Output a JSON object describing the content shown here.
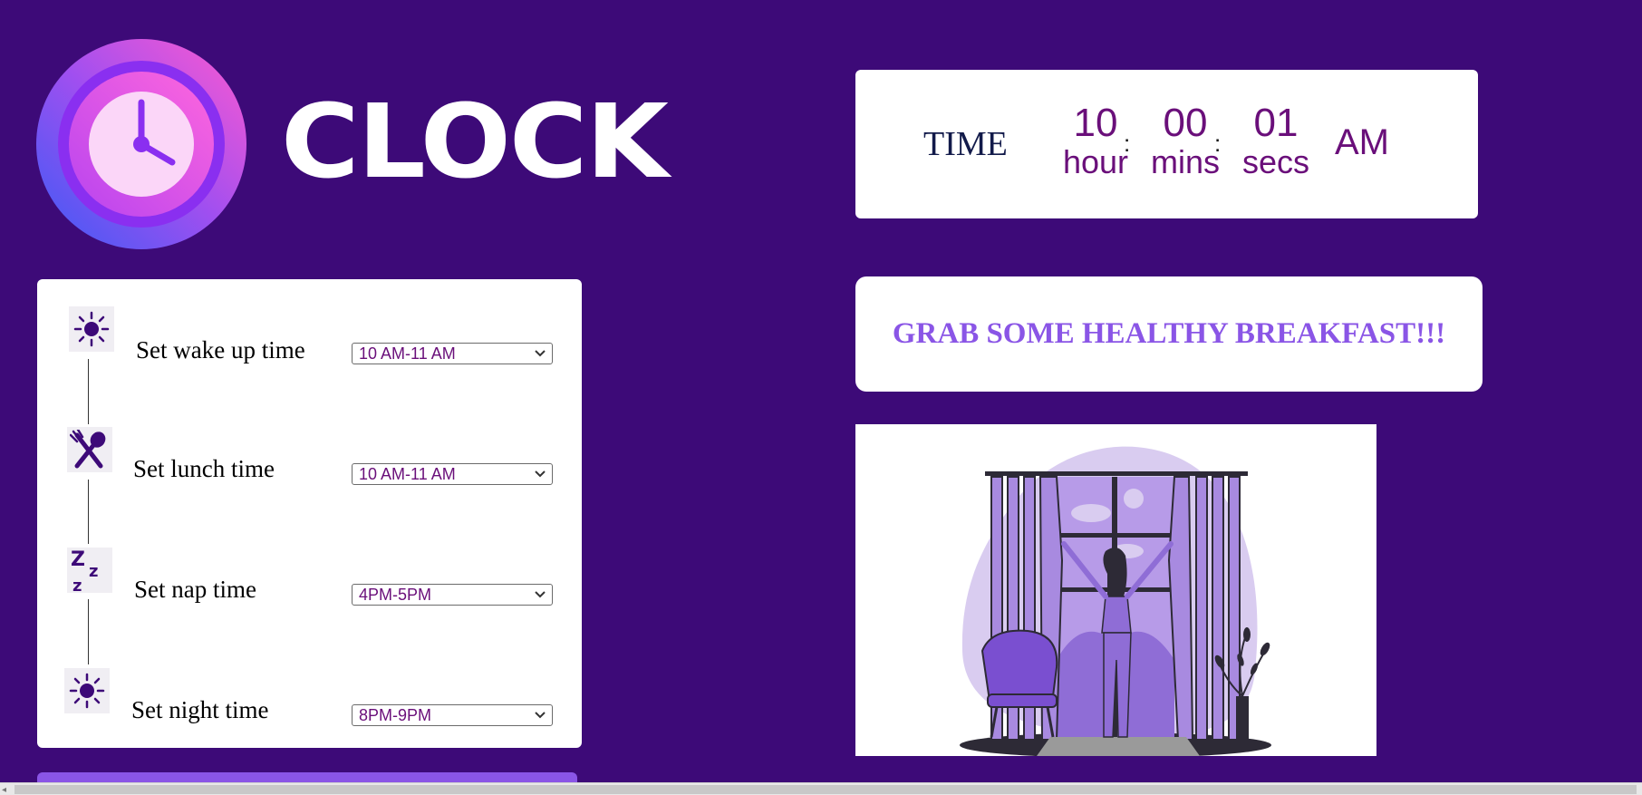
{
  "logo": {
    "title": "CLOCK",
    "icon": "clock-icon"
  },
  "time_display": {
    "label": "TIME",
    "hour": "10",
    "hour_unit": "hour",
    "mins": "00",
    "mins_unit": "mins",
    "secs": "01",
    "secs_unit": "secs",
    "separator": ":",
    "ampm": "AM"
  },
  "message": "GRAB SOME HEALTHY BREAKFAST!!!",
  "schedule": {
    "items": [
      {
        "label": "Set wake up time",
        "icon": "sun-icon",
        "value": "10 AM-11 AM"
      },
      {
        "label": "Set lunch time",
        "icon": "fork-spoon-icon",
        "value": "10 AM-11 AM"
      },
      {
        "label": "Set nap time",
        "icon": "zzz-icon",
        "value": "4PM-5PM"
      },
      {
        "label": "Set night time",
        "icon": "sun-icon",
        "value": "8PM-9PM"
      }
    ]
  },
  "illustration": {
    "icon": "woman-opening-curtains-illustration"
  },
  "colors": {
    "background": "#3d0a78",
    "accent": "#8a55e6",
    "time_text": "#6a0f7a",
    "card": "#ffffff"
  }
}
